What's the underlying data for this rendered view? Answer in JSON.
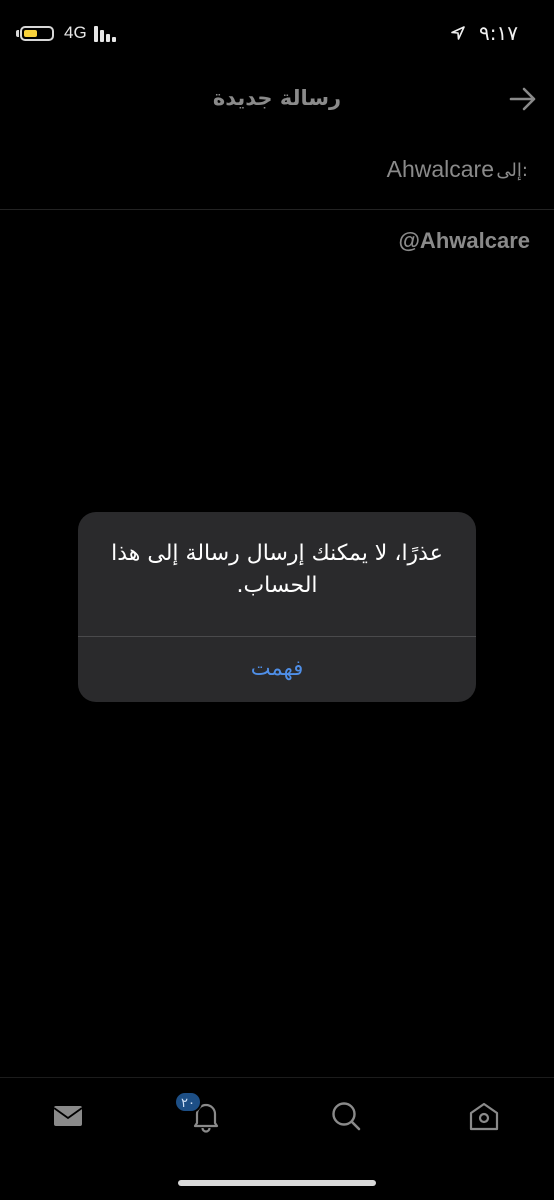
{
  "status_bar": {
    "network": "4G",
    "time": "٩:١٧"
  },
  "header": {
    "title": "رسالة جديدة",
    "back_icon": "arrow-right-icon"
  },
  "recipient": {
    "label": "إلى:",
    "value": "Ahwalcare"
  },
  "profile": {
    "handle": "@Ahwalcare"
  },
  "alert": {
    "message": "عذرًا، لا يمكنك إرسال رسالة إلى هذا الحساب.",
    "button_label": "فهمت"
  },
  "tabbar": {
    "items": [
      {
        "name": "messages",
        "icon": "envelope-icon"
      },
      {
        "name": "notifications",
        "icon": "bell-icon",
        "badge": "٢٠"
      },
      {
        "name": "search",
        "icon": "search-icon"
      },
      {
        "name": "home",
        "icon": "home-icon"
      }
    ]
  },
  "colors": {
    "background": "#000000",
    "alert_background": "#2a2a2c",
    "accent": "#4f8fe8",
    "muted_text": "#8a8a8a",
    "badge": "#1d4f86",
    "battery": "#f7d13b"
  }
}
